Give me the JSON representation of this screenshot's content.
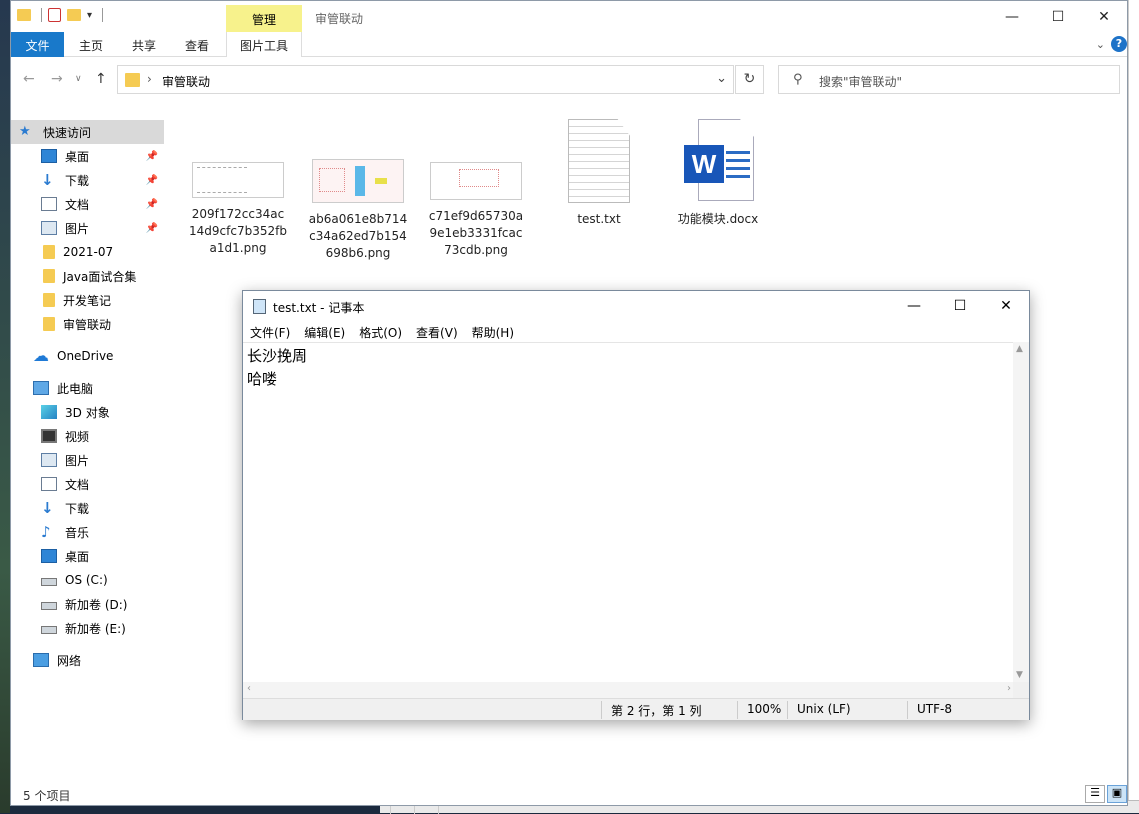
{
  "explorer": {
    "title": "审管联动",
    "context_tab": "管理",
    "ribbon_tabs": [
      "文件",
      "主页",
      "共享",
      "查看",
      "图片工具"
    ],
    "address": "审管联动",
    "search_placeholder": "搜索\"审管联动\"",
    "help": "?",
    "status_count": "5 个项目"
  },
  "nav": {
    "quick_access": "快速访问",
    "items": [
      {
        "label": "桌面",
        "icon": "desktop-icon"
      },
      {
        "label": "下载",
        "icon": "download-icon"
      },
      {
        "label": "文档",
        "icon": "document-icon"
      },
      {
        "label": "图片",
        "icon": "pictures-icon"
      },
      {
        "label": "2021-07",
        "icon": "folder-icon"
      },
      {
        "label": "Java面试合集",
        "icon": "folder-icon"
      },
      {
        "label": "开发笔记",
        "icon": "folder-icon"
      },
      {
        "label": "审管联动",
        "icon": "folder-icon"
      }
    ],
    "onedrive": "OneDrive",
    "this_pc": "此电脑",
    "pc_items": [
      {
        "label": "3D 对象",
        "icon": "3d-objects-icon"
      },
      {
        "label": "视频",
        "icon": "video-icon"
      },
      {
        "label": "图片",
        "icon": "pictures-icon"
      },
      {
        "label": "文档",
        "icon": "document-icon"
      },
      {
        "label": "下载",
        "icon": "download-icon"
      },
      {
        "label": "音乐",
        "icon": "music-icon"
      },
      {
        "label": "桌面",
        "icon": "desktop-icon"
      },
      {
        "label": "OS (C:)",
        "icon": "drive-icon"
      },
      {
        "label": "新加卷 (D:)",
        "icon": "drive-icon"
      },
      {
        "label": "新加卷 (E:)",
        "icon": "drive-icon"
      }
    ],
    "network": "网络"
  },
  "files": [
    {
      "name": "209f172cc34ac14d9cfc7b352fba1d1.png",
      "type": "png"
    },
    {
      "name": "ab6a061e8b714c34a62ed7b154698b6.png",
      "type": "png"
    },
    {
      "name": "c71ef9d65730a9e1eb3331fcac73cdb.png",
      "type": "png"
    },
    {
      "name": "test.txt",
      "type": "txt"
    },
    {
      "name": "功能模块.docx",
      "type": "docx"
    }
  ],
  "notepad": {
    "title": "test.txt - 记事本",
    "menu": [
      "文件(F)",
      "编辑(E)",
      "格式(O)",
      "查看(V)",
      "帮助(H)"
    ],
    "content_lines": [
      "长沙挽周",
      "哈喽"
    ],
    "status_position": "第 2 行，第 1 列",
    "status_zoom": "100%",
    "status_eol": "Unix (LF)",
    "status_encoding": "UTF-8"
  },
  "colors": {
    "accent": "#1979ca",
    "context_tab": "#f7f28c",
    "folder": "#f5cb53",
    "selection": "#d9d9d9"
  }
}
